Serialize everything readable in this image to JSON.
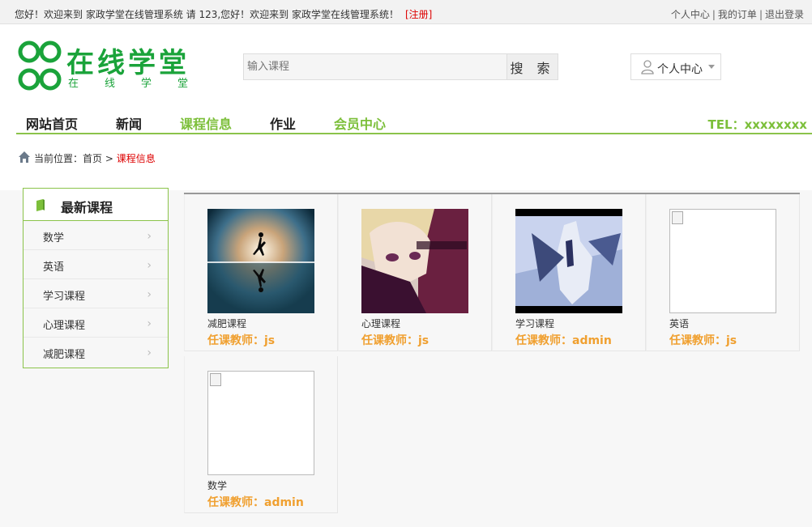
{
  "topbar": {
    "greeting": "您好！欢迎来到 家政学堂在线管理系统 请  123,您好！欢迎来到 家政学堂在线管理系统！",
    "register": "[注册]",
    "links": [
      "个人中心",
      "我的订单",
      "退出登录"
    ],
    "separator": "|"
  },
  "logo": {
    "title": "在线学堂",
    "subtitle": "在线学堂"
  },
  "search": {
    "placeholder": "输入课程",
    "button": "搜 索"
  },
  "user_menu": {
    "label": "个人中心",
    "icon": "user-icon"
  },
  "nav": {
    "items": [
      "网站首页",
      "新闻",
      "课程信息",
      "作业",
      "会员中心"
    ],
    "tel": "TEL：xxxxxxxx",
    "accent": "#7cbf3a"
  },
  "breadcrumb": {
    "prefix": "当前位置：首页 > ",
    "current": "课程信息"
  },
  "sidebar": {
    "title": "最新课程",
    "items": [
      "数学",
      "英语",
      "学习课程",
      "心理课程",
      "减肥课程"
    ]
  },
  "courses": [
    {
      "name": "减肥课程",
      "teacher": "任课教师：js",
      "image": "runner-photo"
    },
    {
      "name": "心理课程",
      "teacher": "任课教师：js",
      "image": "anime-girl-photo"
    },
    {
      "name": "学习课程",
      "teacher": "任课教师：admin",
      "image": "mecha-photo"
    },
    {
      "name": "英语",
      "teacher": "任课教师：js",
      "image": "broken-image"
    },
    {
      "name": "数学",
      "teacher": "任课教师：admin",
      "image": "broken-image"
    }
  ]
}
